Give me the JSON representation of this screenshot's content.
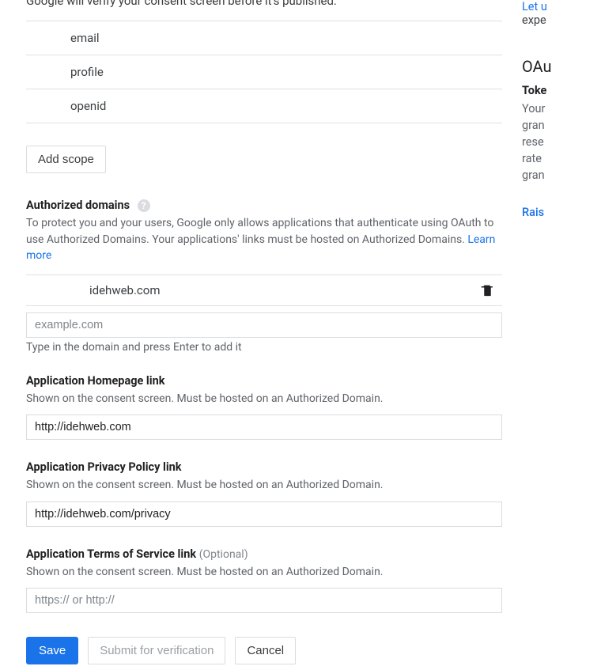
{
  "intro_partial": "Google will verify your consent screen before it's published.",
  "scopes": [
    "email",
    "profile",
    "openid"
  ],
  "add_scope_label": "Add scope",
  "authorized_domains": {
    "label": "Authorized domains",
    "desc_1": "To protect you and your users, Google only allows applications that authenticate using OAuth to use Authorized Domains. Your applications' links must be hosted on Authorized Domains. ",
    "learn_more": "Learn more",
    "items": [
      "idehweb.com"
    ],
    "input_placeholder": "example.com",
    "hint": "Type in the domain and press Enter to add it"
  },
  "homepage": {
    "label": "Application Homepage link",
    "desc": "Shown on the consent screen. Must be hosted on an Authorized Domain.",
    "value": "http://idehweb.com"
  },
  "privacy": {
    "label": "Application Privacy Policy link",
    "desc": "Shown on the consent screen. Must be hosted on an Authorized Domain.",
    "value": "http://idehweb.com/privacy"
  },
  "tos": {
    "label": "Application Terms of Service link ",
    "optional": "(Optional)",
    "desc": "Shown on the consent screen. Must be hosted on an Authorized Domain.",
    "placeholder": "https:// or http://",
    "value": ""
  },
  "actions": {
    "save": "Save",
    "submit": "Submit for verification",
    "cancel": "Cancel"
  },
  "side": {
    "link1": "Let u",
    "text1": "expe",
    "head": "OAu",
    "sub": "Toke",
    "l1": "Your",
    "l2": "gran",
    "l3": "rese",
    "l4": "rate",
    "l5": "gran",
    "raise": "Rais"
  }
}
